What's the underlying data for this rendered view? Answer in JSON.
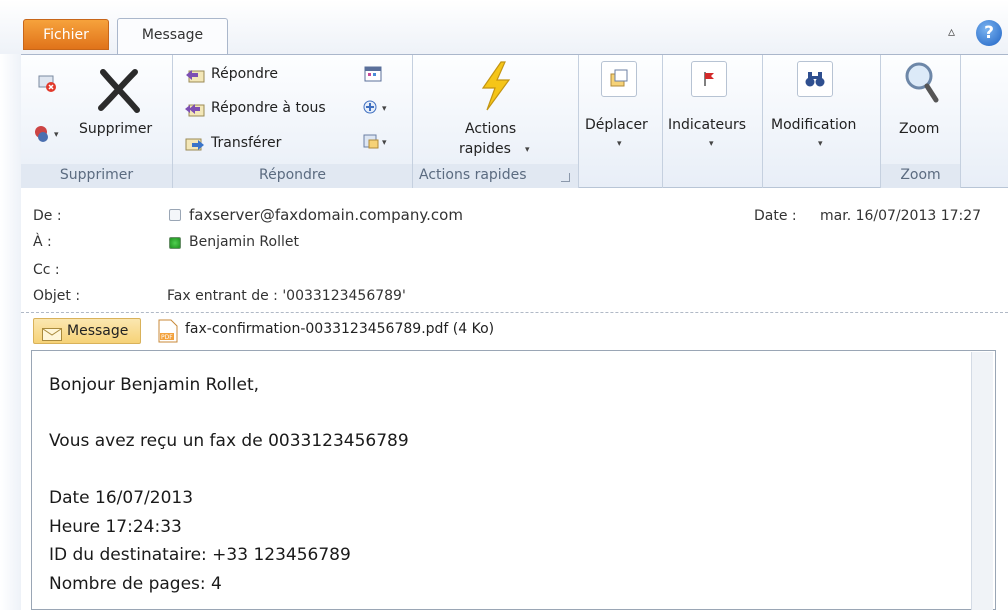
{
  "tabs": {
    "file": "Fichier",
    "message": "Message"
  },
  "ribbon": {
    "delete_group": {
      "delete_label": "Supprimer",
      "group_label": "Supprimer"
    },
    "respond_group": {
      "reply": "Répondre",
      "reply_all": "Répondre à tous",
      "forward": "Transférer",
      "group_label": "Répondre"
    },
    "quick_group": {
      "line1": "Actions",
      "line2": "rapides",
      "group_label": "Actions rapides"
    },
    "move": "Déplacer",
    "tags": "Indicateurs",
    "edit": "Modification",
    "zoom_group": {
      "zoom": "Zoom",
      "group_label": "Zoom"
    }
  },
  "header": {
    "from_label": "De :",
    "from_value": "faxserver@faxdomain.company.com",
    "to_label": "À :",
    "to_value": "Benjamin Rollet",
    "cc_label": "Cc :",
    "subject_label": "Objet :",
    "subject_value": "Fax entrant de : '0033123456789'",
    "date_label": "Date :",
    "date_value": "mar. 16/07/2013 17:27"
  },
  "attachments": {
    "message_tab": "Message",
    "file": "fax-confirmation-0033123456789.pdf (4 Ko)"
  },
  "body": {
    "greeting": "Bonjour Benjamin Rollet,",
    "line1": "Vous avez reçu un fax de 0033123456789",
    "date": "Date 16/07/2013",
    "time": "Heure 17:24:33",
    "recipient": "ID du destinataire: +33 123456789",
    "pages": "Nombre de pages: 4"
  },
  "colors": {
    "file_tab": "#e8811f",
    "ribbon_bg": "#e8eef7",
    "accent_blue": "#1f63c4"
  }
}
